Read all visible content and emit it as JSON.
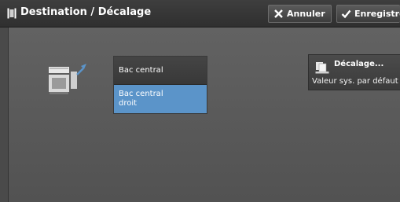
{
  "header": {
    "title": "Destination / Décalage",
    "cancel_label": "Annuler",
    "save_label": "Enregistrer"
  },
  "output_options": [
    {
      "label": "Bac central",
      "selected": false
    },
    {
      "label": "Bac central\ndroit",
      "selected": true
    }
  ],
  "offset": {
    "label": "Décalage...",
    "value": "Valeur sys. par défaut"
  },
  "colors": {
    "selected": "#5b94c9",
    "panel": "#5a5a5a",
    "titlebar": "#333333"
  },
  "icons": {
    "title": "output-tray-icon",
    "cancel": "x-icon",
    "save": "checkmark-icon",
    "device": "printer-device-icon",
    "offset": "offset-stack-icon"
  }
}
